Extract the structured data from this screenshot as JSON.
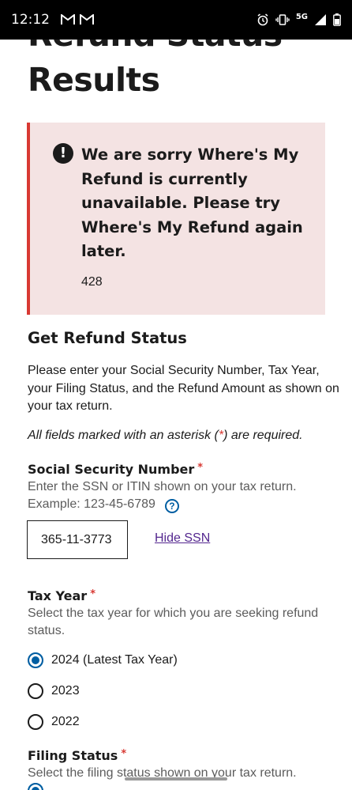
{
  "status_bar": {
    "time": "12:12",
    "network": "5G"
  },
  "page": {
    "title_line1": "Refund Status",
    "title_line2": "Results"
  },
  "alert": {
    "heading": "We are sorry Where's My Refund is currently unavailable. Please try Where's My Refund again later.",
    "code": "428",
    "icon": "exclamation-circle-icon",
    "border_color": "#d83933",
    "background": "#f4e3e3"
  },
  "form": {
    "section_title": "Get Refund Status",
    "intro": "Please enter your Social Security Number, Tax Year, your Filing Status, and the Refund Amount as shown on your tax return.",
    "required_note_before": "All fields marked with an asterisk (",
    "required_note_asterisk": "*",
    "required_note_after": ") are required.",
    "ssn": {
      "label": "Social Security Number",
      "required_mark": "*",
      "hint_line1": "Enter the SSN or ITIN shown on your tax return.",
      "hint_line2": "Example: 123-45-6789",
      "help_icon": "?",
      "value": "365-11-3773",
      "toggle_label": "Hide SSN"
    },
    "tax_year": {
      "label": "Tax Year",
      "required_mark": "*",
      "hint": "Select the tax year for which you are seeking refund status.",
      "options": [
        {
          "label": "2024 (Latest Tax Year)",
          "selected": true
        },
        {
          "label": "2023",
          "selected": false
        },
        {
          "label": "2022",
          "selected": false
        }
      ]
    },
    "filing_status": {
      "label": "Filing Status",
      "required_mark": "*",
      "hint": "Select the filing status shown on your tax return."
    }
  },
  "colors": {
    "primary": "#005ea2",
    "link_visited": "#54278f",
    "error": "#d83933"
  }
}
